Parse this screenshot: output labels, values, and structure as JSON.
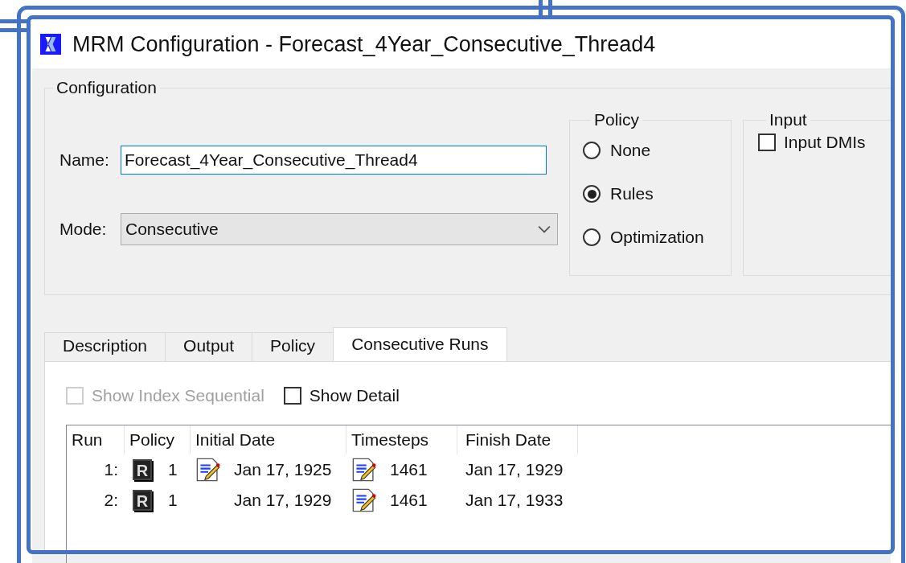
{
  "window": {
    "title": "MRM Configuration - Forecast_4Year_Consecutive_Thread4"
  },
  "configuration": {
    "title": "Configuration",
    "name_label": "Name:",
    "name_value": "Forecast_4Year_Consecutive_Thread4",
    "mode_label": "Mode:",
    "mode_value": "Consecutive",
    "policy": {
      "title": "Policy",
      "options": [
        {
          "label": "None",
          "selected": false
        },
        {
          "label": "Rules",
          "selected": true
        },
        {
          "label": "Optimization",
          "selected": false
        }
      ]
    },
    "input": {
      "title": "Input",
      "checkbox": {
        "label": "Input DMIs",
        "checked": false
      }
    }
  },
  "tabs": [
    {
      "label": "Description",
      "selected": false
    },
    {
      "label": "Output",
      "selected": false
    },
    {
      "label": "Policy",
      "selected": false
    },
    {
      "label": "Consecutive Runs",
      "selected": true
    }
  ],
  "options": [
    {
      "label": "Show Index Sequential",
      "checked": false,
      "disabled": true
    },
    {
      "label": "Show Detail",
      "checked": false,
      "disabled": false
    }
  ],
  "table": {
    "columns": [
      "Run",
      "Policy",
      "Initial Date",
      "Timesteps",
      "Finish Date"
    ],
    "rows": [
      {
        "run": "1:",
        "policy_badge": "R",
        "policy": "1",
        "initial_editable": true,
        "initial_date": "Jan 17, 1925",
        "timesteps_editable": true,
        "timesteps": "1461",
        "finish_date": "Jan 17, 1929"
      },
      {
        "run": "2:",
        "policy_badge": "R",
        "policy": "1",
        "initial_editable": false,
        "initial_date": "Jan 17, 1929",
        "timesteps_editable": true,
        "timesteps": "1461",
        "finish_date": "Jan 17, 1933"
      }
    ]
  }
}
